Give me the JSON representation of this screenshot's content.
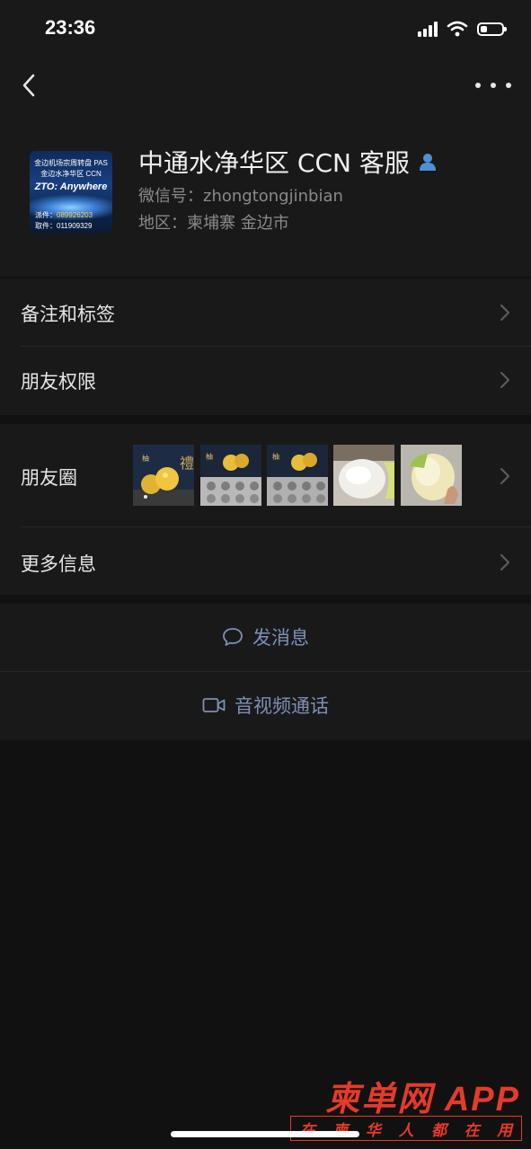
{
  "status_bar": {
    "time": "23:36",
    "battery_level": 0.3,
    "icons": [
      "cellular-signal-icon",
      "wifi-icon",
      "battery-icon"
    ]
  },
  "nav": {
    "back_icon": "chevron-left-icon",
    "more_icon": "ellipsis-icon"
  },
  "profile": {
    "name": "中通水净华区 CCN 客服",
    "verified_icon": "person-icon",
    "wechat_id": "微信号：zhongtongjinbian",
    "region": "地区：柬埔寨 金边市",
    "avatar": {
      "line1": "金边机场宗周转盘 PAS",
      "line2": "金边水净华区 CCN",
      "brand": "ZTO: Anywhere",
      "send_label": "派件：",
      "send_phone": "089926203",
      "pickup_label": "取件：",
      "pickup_phone": "011909329"
    }
  },
  "settings": {
    "remarks_tags": "备注和标签",
    "friend_permissions": "朋友权限"
  },
  "moments": {
    "label": "朋友圈",
    "photos": [
      "pomelo-box-photo",
      "pomelo-tray-photo",
      "pomelo-tray-photo",
      "pomelo-flesh-photo",
      "pomelo-peeled-photo"
    ]
  },
  "more_info": "更多信息",
  "actions": {
    "send_message": "发消息",
    "video_call": "音视频通话"
  },
  "watermark": {
    "title": "柬单网",
    "app": "APP",
    "slogan": [
      "在",
      "柬",
      "华",
      "人",
      "都",
      "在",
      "用"
    ]
  },
  "colors": {
    "background": "#111111",
    "panel": "#191919",
    "action_text": "#7d90b5",
    "watermark": "#e63a2a"
  }
}
